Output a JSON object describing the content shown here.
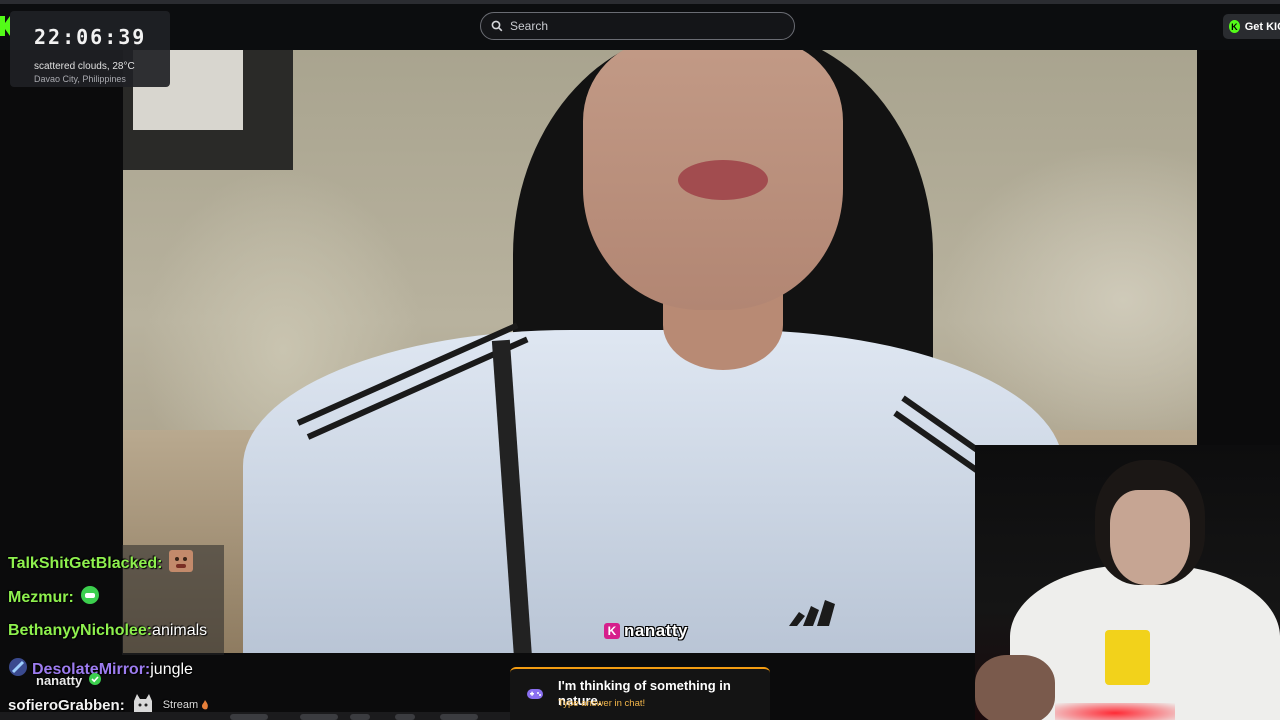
{
  "header": {
    "search": {
      "placeholder": "Search"
    },
    "kick_button": {
      "label": "Get KICK"
    }
  },
  "overlay": {
    "clock": {
      "time": "22:06:39",
      "weather": "scattered clouds, 28°C",
      "location": "Davao City, Philippines"
    },
    "streamer_tag": "nanatty",
    "cam_name": "nanatty"
  },
  "chat": {
    "messages": [
      {
        "user": "TalkShitGetBlacked",
        "separator": ":",
        "text": "",
        "color": "#8ef04e",
        "emote": "face-emote"
      },
      {
        "user": "Mezmur",
        "separator": ":",
        "text": "",
        "color": "#8ef04e",
        "emote": "green-smile-emote"
      },
      {
        "user": "BethanyyNicholee",
        "separator": ":",
        "text": " animals",
        "color": "#8ef04e"
      },
      {
        "user": "DesolateMirror",
        "separator": ":",
        "text": " jungle",
        "color": "#9d7cf0",
        "badge": "sword-badge"
      },
      {
        "user": "sofieroGrabben",
        "separator": ":",
        "text": "",
        "color": "#f2f2f2",
        "emote": "cat-emote"
      }
    ],
    "stream_badge": "Stream"
  },
  "game_banner": {
    "title": "I'm thinking of something in nature.",
    "subtitle": "Type answer in chat!",
    "accent": "#f39c12"
  },
  "colors": {
    "brand": "#53fc18",
    "chat_green": "#8ef04e",
    "chat_purple": "#9d7cf0"
  }
}
